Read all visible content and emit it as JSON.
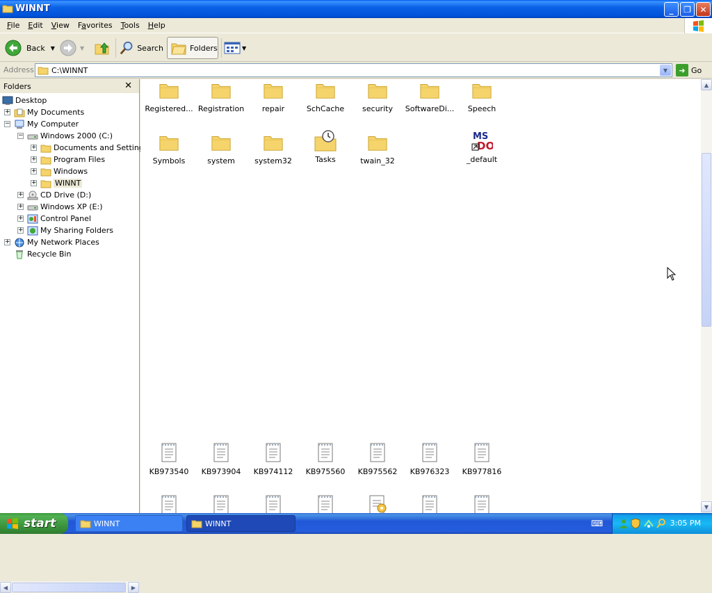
{
  "window": {
    "title": "WINNT"
  },
  "menu": [
    "File",
    "Edit",
    "View",
    "Favorites",
    "Tools",
    "Help"
  ],
  "menu_underline": [
    "F",
    "E",
    "V",
    "a",
    "T",
    "H"
  ],
  "toolbar": {
    "back": "Back",
    "search": "Search",
    "folders": "Folders"
  },
  "address": {
    "label": "Address",
    "value": "C:\\WINNT",
    "go": "Go"
  },
  "folders_pane": {
    "title": "Folders",
    "tree": [
      {
        "label": "Desktop"
      },
      {
        "label": "My Documents"
      },
      {
        "label": "My Computer"
      },
      {
        "label": "Windows 2000 (C:)"
      },
      {
        "label": "Documents and Settings"
      },
      {
        "label": "Program Files"
      },
      {
        "label": "Windows"
      },
      {
        "label": "WINNT"
      },
      {
        "label": "CD Drive (D:)"
      },
      {
        "label": "Windows XP (E:)"
      },
      {
        "label": "Control Panel"
      },
      {
        "label": "My Sharing Folders"
      },
      {
        "label": "My Network Places"
      },
      {
        "label": "Recycle Bin"
      }
    ]
  },
  "items": [
    {
      "label": "Registered..."
    },
    {
      "label": "Registration"
    },
    {
      "label": "repair"
    },
    {
      "label": "SchCache"
    },
    {
      "label": "security"
    },
    {
      "label": "SoftwareDi..."
    },
    {
      "label": "Speech"
    },
    {
      "label": "Symbols"
    },
    {
      "label": "system"
    },
    {
      "label": "system32"
    },
    {
      "label": "Tasks"
    },
    {
      "label": "twain_32"
    },
    {
      "label": "_default"
    },
    {
      "label": "KB973540"
    },
    {
      "label": "KB973904"
    },
    {
      "label": "KB974112"
    },
    {
      "label": "KB975560"
    },
    {
      "label": "KB975562"
    },
    {
      "label": "KB976323"
    },
    {
      "label": "KB977816"
    }
  ],
  "taskbar": {
    "start": "start",
    "tasks": [
      {
        "label": "WINNT"
      },
      {
        "label": "WINNT"
      }
    ],
    "clock": "3:05 PM"
  },
  "colors": {
    "folder": "#f5d46b",
    "folder_dark": "#c9a231",
    "taskbar": "#245edc",
    "start": "#3d953d"
  }
}
